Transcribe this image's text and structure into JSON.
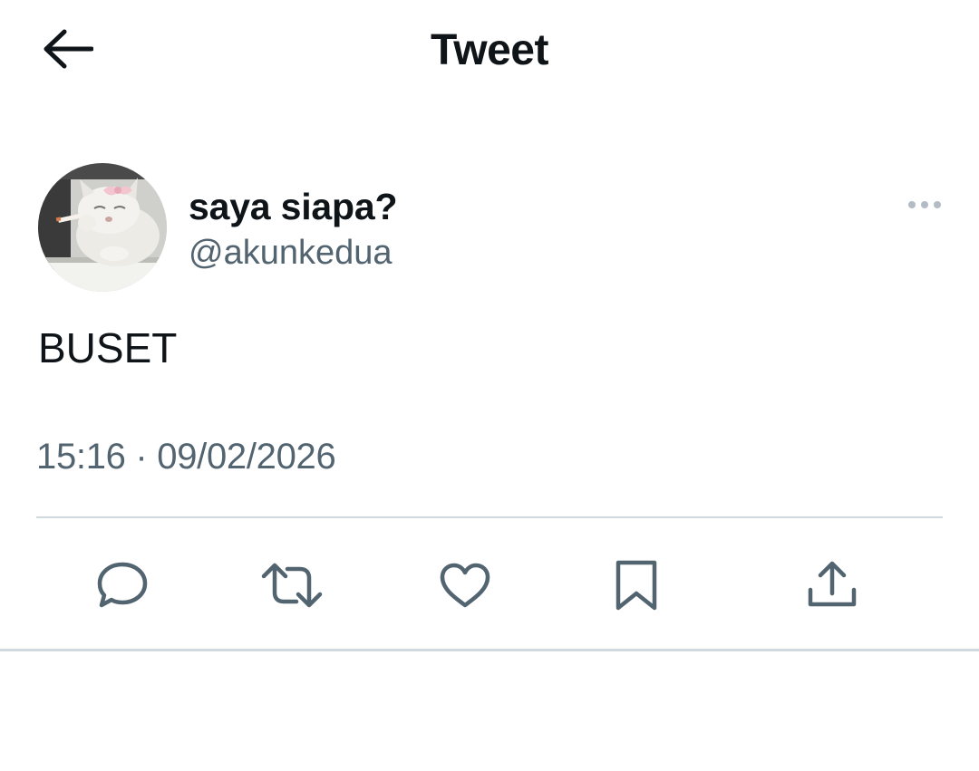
{
  "header": {
    "title": "Tweet",
    "back_icon": "arrow-left-icon"
  },
  "tweet": {
    "author": {
      "display_name": "saya siapa?",
      "handle": "@akunkedua",
      "avatar": "avatar-cat-photo"
    },
    "more_icon": "more-horizontal-icon",
    "text": "BUSET",
    "timestamp": "15:16 · 09/02/2026"
  },
  "actions": [
    {
      "name": "reply",
      "icon": "reply-icon"
    },
    {
      "name": "retweet",
      "icon": "retweet-icon"
    },
    {
      "name": "like",
      "icon": "heart-icon"
    },
    {
      "name": "bookmark",
      "icon": "bookmark-icon"
    },
    {
      "name": "share",
      "icon": "share-icon"
    }
  ],
  "colors": {
    "text_primary": "#0f1419",
    "text_secondary": "#536471",
    "divider": "#cfd9de",
    "icon": "#536471"
  }
}
